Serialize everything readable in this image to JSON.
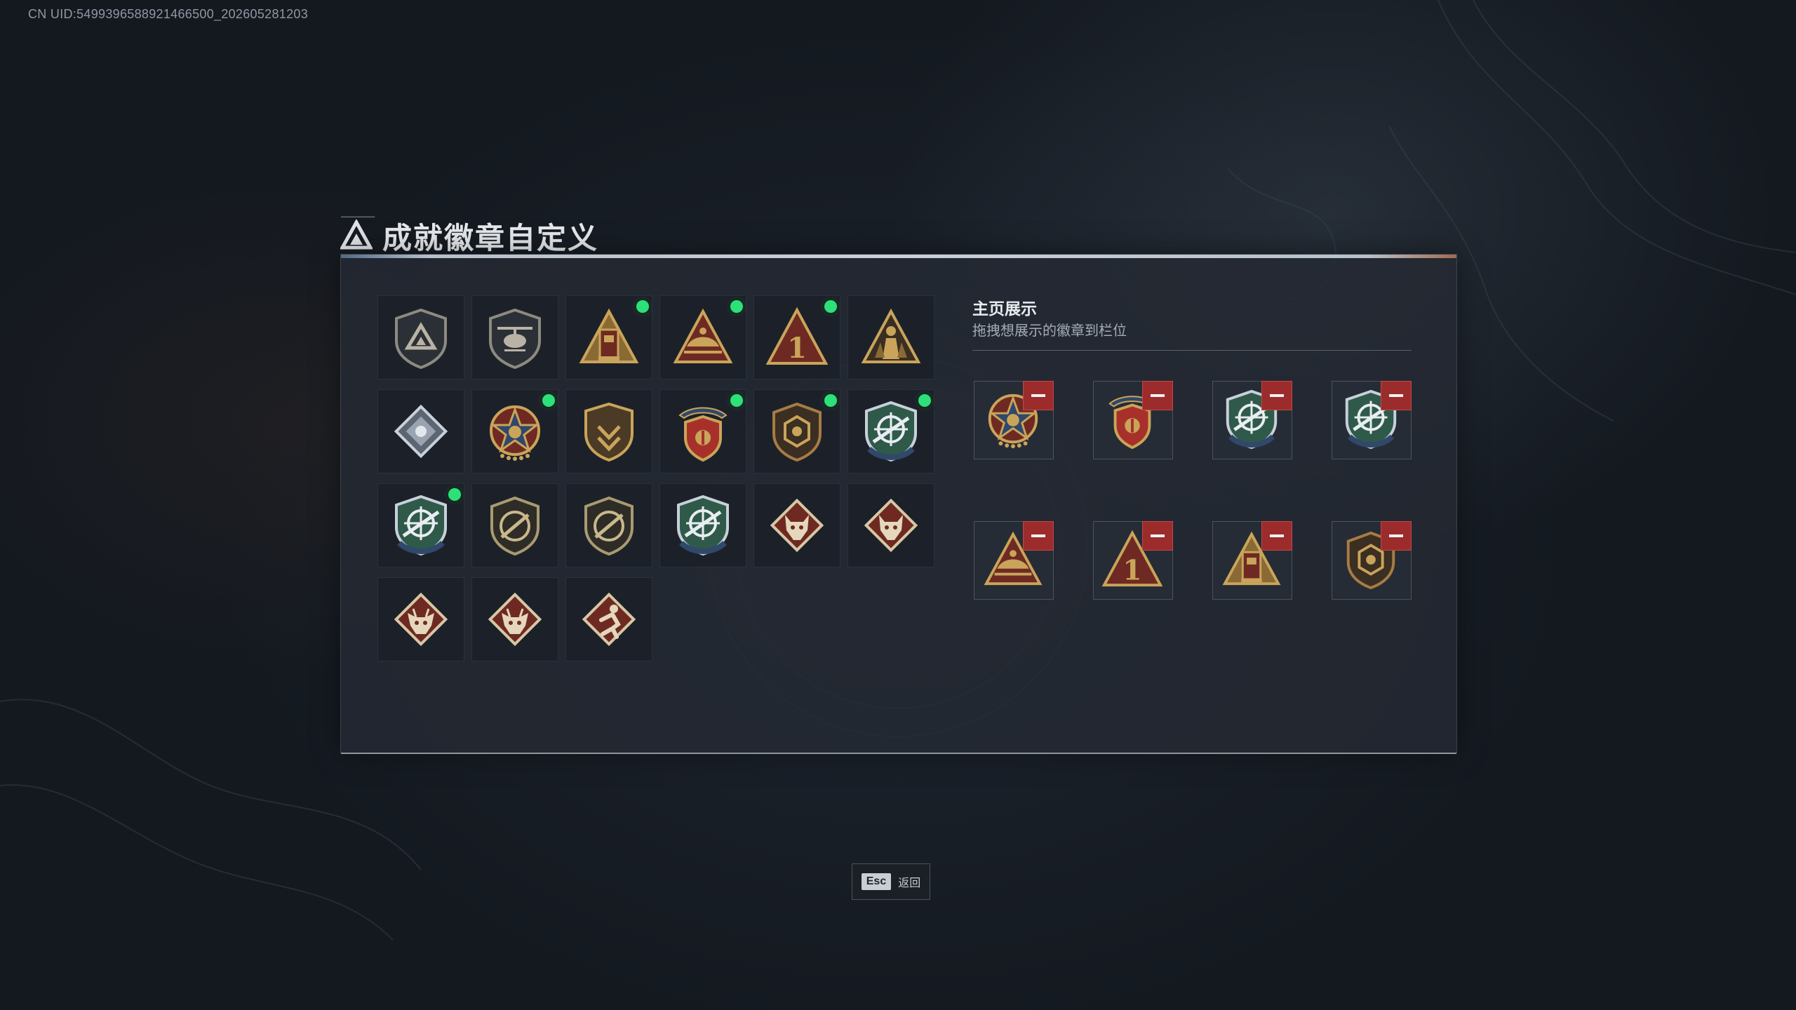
{
  "uid_text": "CN UID:5499396588921466500_202605281203",
  "title": "成就徽章自定义",
  "showcase": {
    "title": "主页展示",
    "subtitle": "拖拽想展示的徽章到栏位"
  },
  "footer": {
    "key": "Esc",
    "label": "返回"
  },
  "colors": {
    "new_dot": "#2ee07a",
    "remove_button": "#9c2c2c",
    "panel_bg": "#242a33",
    "gold": "#c9a45a",
    "maroon": "#6e2a22",
    "steel_blue": "#30486a"
  },
  "badges": [
    {
      "icon": "shield-triangle-icon",
      "new": false
    },
    {
      "icon": "helicopter-icon",
      "new": false
    },
    {
      "icon": "gold-tower-icon",
      "new": true
    },
    {
      "icon": "gold-boat-triangle-icon",
      "new": true
    },
    {
      "icon": "rank-one-triangle-icon",
      "new": true
    },
    {
      "icon": "soldier-triangle-icon",
      "new": false
    },
    {
      "icon": "silver-diamond-emblem-icon",
      "new": false
    },
    {
      "icon": "star-medal-icon",
      "new": true
    },
    {
      "icon": "shield-chevron-icon",
      "new": false
    },
    {
      "icon": "winged-crest-icon",
      "new": true
    },
    {
      "icon": "bronze-crest-icon",
      "new": true
    },
    {
      "icon": "blue-crosshair-shield-icon",
      "new": true
    },
    {
      "icon": "blue-crosshair-shield-icon",
      "new": true
    },
    {
      "icon": "rifle-badge-icon",
      "new": false
    },
    {
      "icon": "rifle-badge-icon",
      "new": false
    },
    {
      "icon": "blue-crosshair-shield-icon",
      "new": false
    },
    {
      "icon": "wolf-diamond-icon",
      "new": false
    },
    {
      "icon": "wolf-diamond-icon",
      "new": false
    },
    {
      "icon": "dragon-diamond-icon",
      "new": false
    },
    {
      "icon": "dragon-diamond-icon",
      "new": false
    },
    {
      "icon": "runner-diamond-icon",
      "new": false
    }
  ],
  "showcase_slots": [
    {
      "icon": "star-medal-icon"
    },
    {
      "icon": "winged-crest-icon"
    },
    {
      "icon": "blue-crosshair-shield-icon"
    },
    {
      "icon": "blue-crosshair-shield-icon"
    },
    {
      "icon": "gold-boat-triangle-icon"
    },
    {
      "icon": "rank-one-triangle-icon"
    },
    {
      "icon": "gold-tower-icon"
    },
    {
      "icon": "bronze-crest-icon"
    }
  ]
}
